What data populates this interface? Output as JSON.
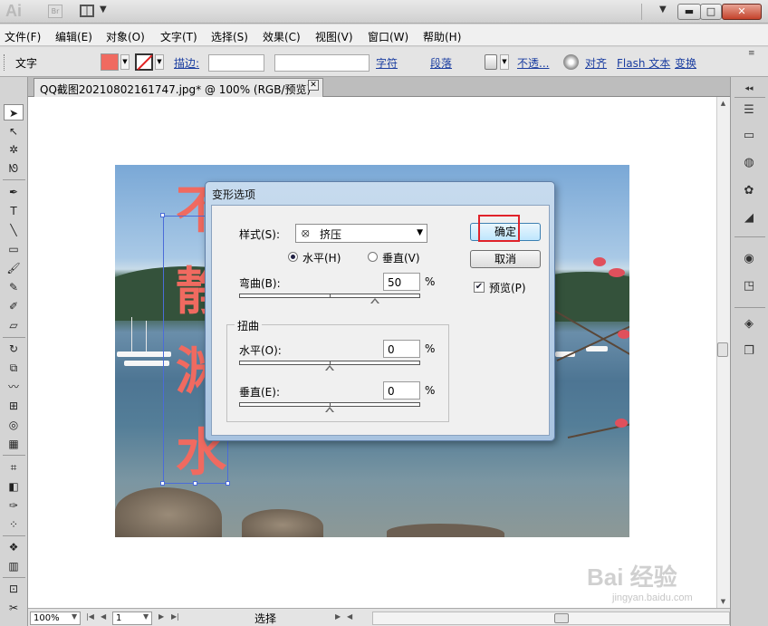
{
  "app": {
    "logo": "Ai",
    "bridge_badge": "Br",
    "window_buttons": {
      "minimize": "▬",
      "maximize": "□",
      "close": "✕"
    }
  },
  "menu": [
    "文件(F)",
    "编辑(E)",
    "对象(O)",
    "文字(T)",
    "选择(S)",
    "效果(C)",
    "视图(V)",
    "窗口(W)",
    "帮助(H)"
  ],
  "control_bar": {
    "mode_label": "文字",
    "fill_color": "#f06a60",
    "stroke_label": "描边:",
    "links": [
      "字符",
      "段落",
      "不透...",
      "对齐",
      "Flash 文本",
      "变换"
    ]
  },
  "document": {
    "tab_title": "QQ截图20210802161747.jpg* @ 100% (RGB/预览)",
    "tab_close": "✕",
    "art_text": [
      "不",
      "静",
      "渊",
      "水"
    ]
  },
  "dialog": {
    "title": "变形选项",
    "style_label": "样式(S):",
    "style_value": "挤压",
    "orientation": {
      "horizontal": "水平(H)",
      "vertical": "垂直(V)",
      "selected": "horizontal"
    },
    "bend_label": "弯曲(B):",
    "bend_value": "50",
    "percent": "%",
    "distortion_group": "扭曲",
    "dist_h_label": "水平(O):",
    "dist_h_value": "0",
    "dist_v_label": "垂直(E):",
    "dist_v_value": "0",
    "ok": "确定",
    "cancel": "取消",
    "preview_label": "预览(P)",
    "preview_checked": true,
    "highlight_color": "#e0222a"
  },
  "status": {
    "zoom": "100%",
    "page": "1",
    "tool": "选择"
  },
  "watermark": {
    "main": "Bai 经验",
    "sub": "jingyan.baidu.com"
  }
}
